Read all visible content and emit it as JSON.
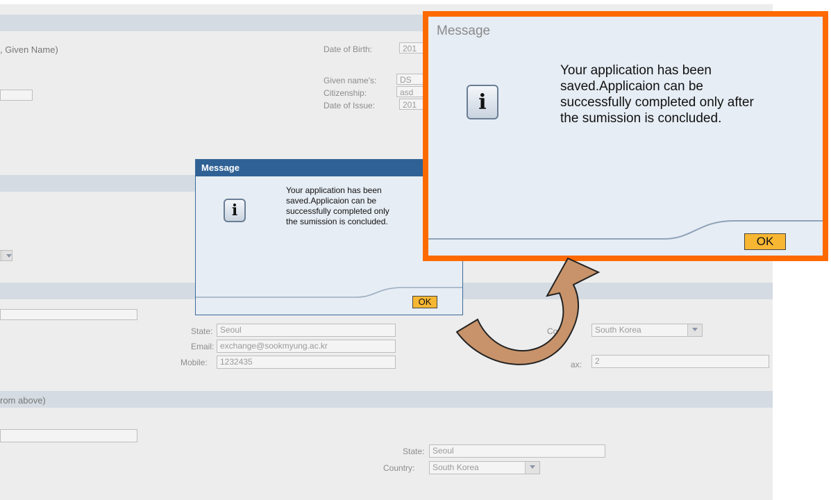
{
  "form": {
    "given_name_hint": ", Given Name)",
    "date_of_birth_label": "Date of Birth:",
    "date_of_birth_value": "201",
    "given_names_label": "Given name's:",
    "given_names_value": "DS",
    "citizenship_label": "Citizenship:",
    "citizenship_value": "asd",
    "date_of_issue_label": "Date of Issue:",
    "date_of_issue_value": "201",
    "state_label": "State:",
    "state_value": "Seoul",
    "email_label": "Email:",
    "email_value": "exchange@sookmyung.ac.kr",
    "mobile_label": "Mobile:",
    "mobile_value": "1232435",
    "country_label_partial": "Cou",
    "country_value": "South Korea",
    "fax_label_partial": "ax:",
    "fax_value": "2",
    "from_above_hint": "rom above)",
    "state2_label": "State:",
    "state2_value": "Seoul",
    "country2_label": "Country:",
    "country2_value": "South Korea"
  },
  "dialog_small": {
    "title": "Message",
    "line1": "Your application has been",
    "line2": "saved.Applicaion can be",
    "line3": "successfully completed only",
    "line4": "the sumission is concluded.",
    "ok_label": "OK"
  },
  "dialog_zoom": {
    "title": "Message",
    "line1": "Your application has been",
    "line2": "saved.Applicaion can be",
    "line3": "successfully completed only after",
    "line4": "the sumission is concluded.",
    "ok_label": "OK"
  },
  "colors": {
    "highlight_frame": "#ff6a00",
    "dialog_title_bar": "#2f6195",
    "ok_button": "#f7b733",
    "arrow_fill": "#c8936a"
  }
}
